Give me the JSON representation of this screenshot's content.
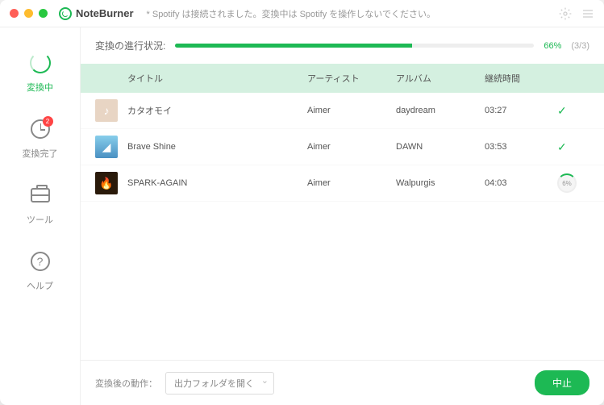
{
  "app": {
    "name": "NoteBurner"
  },
  "status_message": "* Spotify は接続されました。変換中は Spotify を操作しないでください。",
  "sidebar": {
    "items": [
      {
        "label": "変換中",
        "badge": null
      },
      {
        "label": "変換完了",
        "badge": "2"
      },
      {
        "label": "ツール",
        "badge": null
      },
      {
        "label": "ヘルプ",
        "badge": null
      }
    ]
  },
  "progress": {
    "label": "変換の進行状況:",
    "percent_text": "66%",
    "percent_value": 66,
    "count": "(3/3)"
  },
  "columns": {
    "title": "タイトル",
    "artist": "アーティスト",
    "album": "アルバム",
    "duration": "継続時間"
  },
  "tracks": [
    {
      "title": "カタオモイ",
      "artist": "Aimer",
      "album": "daydream",
      "duration": "03:27",
      "status": "done",
      "thumb_bg": "#e8d5c4"
    },
    {
      "title": "Brave Shine",
      "artist": "Aimer",
      "album": "DAWN",
      "duration": "03:53",
      "status": "done",
      "thumb_bg": "#4a90c2"
    },
    {
      "title": "SPARK-AGAIN",
      "artist": "Aimer",
      "album": "Walpurgis",
      "duration": "04:03",
      "status": "progress",
      "progress_text": "6%",
      "thumb_bg": "#2a1a0a"
    }
  ],
  "footer": {
    "label": "変換後の動作：",
    "dropdown_value": "出力フォルダを開く",
    "stop_button": "中止"
  }
}
